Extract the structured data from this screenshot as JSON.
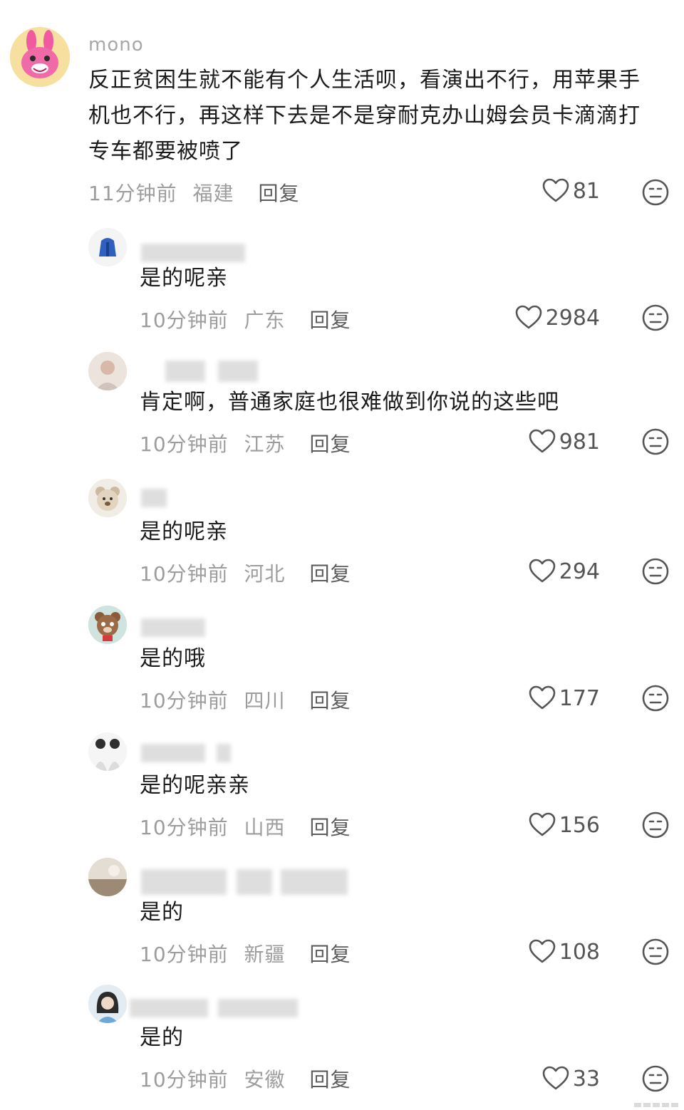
{
  "main_comment": {
    "username": "mono",
    "text": "反正贫困生就不能有个人生活呗，看演出不行，用苹果手机也不行，再这样下去是不是穿耐克办山姆会员卡滴滴打专车都要被喷了",
    "line1": "反正贫困生就不能有个人生活呗，看演出不行，用苹果手",
    "line2": "机也不行，再这样下去是不是穿耐克办山姆会员卡滴滴打",
    "line3": "专车都要被喷了",
    "time": "11分钟前",
    "region": "福建",
    "reply_label": "回复",
    "likes": "81"
  },
  "replies": [
    {
      "text": "是的呢亲",
      "time": "10分钟前",
      "region": "广东",
      "reply_label": "回复",
      "likes": "2984"
    },
    {
      "text": "肯定啊，普通家庭也很难做到你说的这些吧",
      "time": "10分钟前",
      "region": "江苏",
      "reply_label": "回复",
      "likes": "981"
    },
    {
      "text": "是的呢亲",
      "time": "10分钟前",
      "region": "河北",
      "reply_label": "回复",
      "likes": "294"
    },
    {
      "text": "是的哦",
      "time": "10分钟前",
      "region": "四川",
      "reply_label": "回复",
      "likes": "177"
    },
    {
      "text": "是的呢亲亲",
      "time": "10分钟前",
      "region": "山西",
      "reply_label": "回复",
      "likes": "156"
    },
    {
      "text": "是的",
      "time": "10分钟前",
      "region": "新疆",
      "reply_label": "回复",
      "likes": "108"
    },
    {
      "text": "是的",
      "time": "10分钟前",
      "region": "安徽",
      "reply_label": "回复",
      "likes": "33"
    }
  ],
  "icons": {
    "like": "heart-outline-icon",
    "dislike": "neutral-face-icon"
  }
}
